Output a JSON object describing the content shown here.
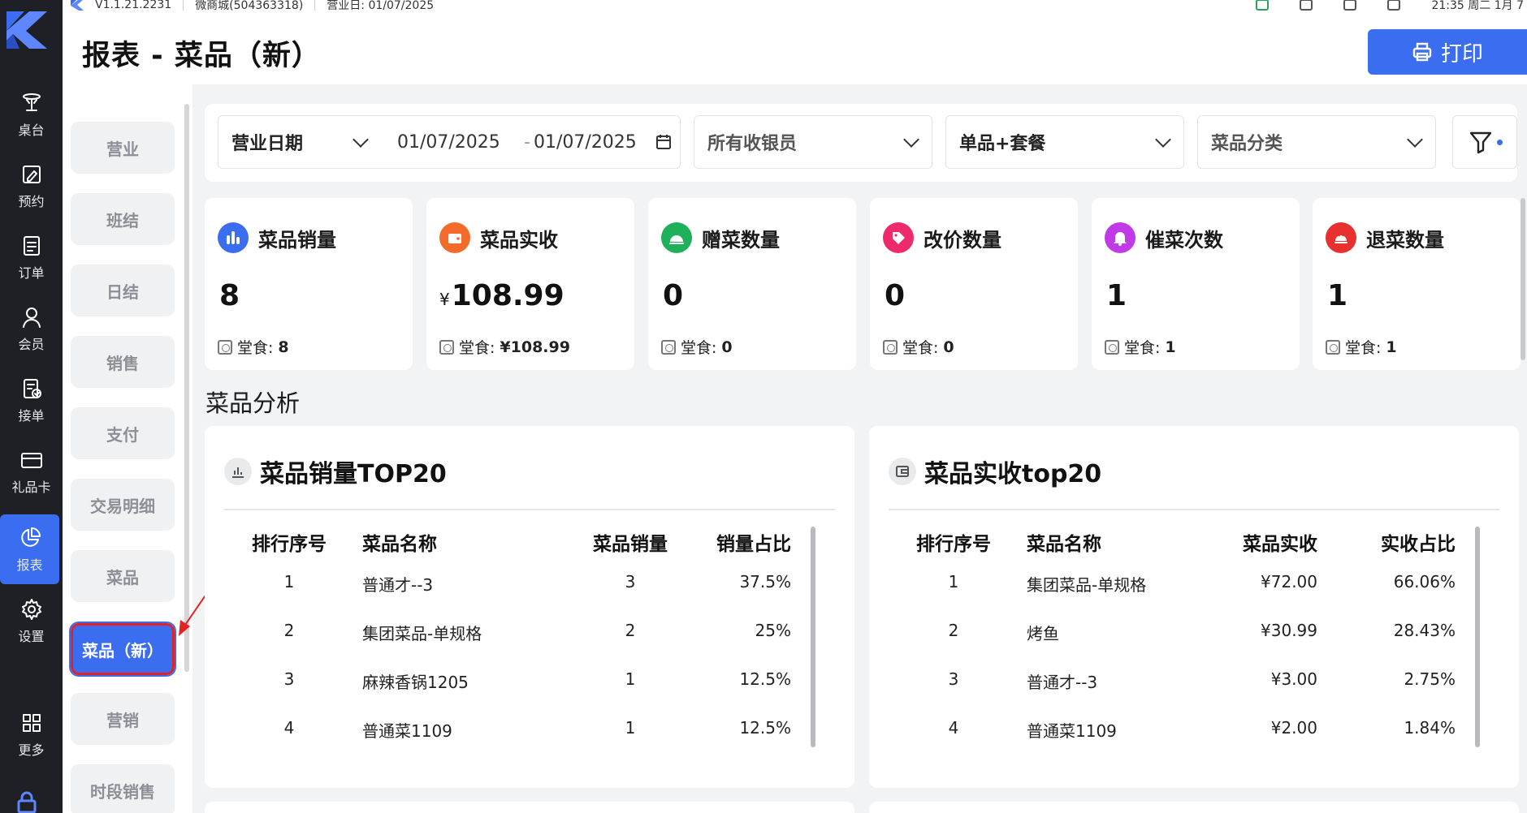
{
  "status": {
    "version": "V1.1.21.2231",
    "store": "微商城(504363318)",
    "business_day": "营业日: 01/07/2025",
    "clock": "21:35 周二 1月 7"
  },
  "header": {
    "title": "报表 - 菜品（新）",
    "print_label": "打印"
  },
  "rail": {
    "items": [
      {
        "label": "桌台",
        "icon": "table-lamp-icon"
      },
      {
        "label": "预约",
        "icon": "calendar-edit-icon"
      },
      {
        "label": "订单",
        "icon": "order-list-icon"
      },
      {
        "label": "会员",
        "icon": "user-icon"
      },
      {
        "label": "接单",
        "icon": "accept-order-icon"
      },
      {
        "label": "礼品卡",
        "icon": "gift-card-icon"
      },
      {
        "label": "报表",
        "icon": "pie-chart-icon",
        "active": true
      },
      {
        "label": "设置",
        "icon": "gear-icon"
      },
      {
        "label": "更多",
        "icon": "grid-icon"
      }
    ]
  },
  "categories": [
    {
      "label": "营业"
    },
    {
      "label": "班结"
    },
    {
      "label": "日结"
    },
    {
      "label": "销售"
    },
    {
      "label": "支付"
    },
    {
      "label": "交易明细"
    },
    {
      "label": "菜品"
    },
    {
      "label": "菜品（新）",
      "active": true
    },
    {
      "label": "营销"
    },
    {
      "label": "时段销售"
    }
  ],
  "filters": {
    "date_type": "营业日期",
    "date_from": "01/07/2025",
    "date_sep": "-",
    "date_to": "01/07/2025",
    "cashier": "所有收银员",
    "item_type": "单品+套餐",
    "dish_category": "菜品分类"
  },
  "cards": [
    {
      "title": "菜品销量",
      "value": "8",
      "currency": "",
      "sub_label": "堂食:",
      "sub_value": "8",
      "color": "#3b6df0",
      "icon": "bar-chart-icon"
    },
    {
      "title": "菜品实收",
      "value": "108.99",
      "currency": "¥",
      "sub_label": "堂食:",
      "sub_value": "¥108.99",
      "color": "#f26b2a",
      "icon": "wallet-icon"
    },
    {
      "title": "赠菜数量",
      "value": "0",
      "currency": "",
      "sub_label": "堂食:",
      "sub_value": "0",
      "color": "#1fb05a",
      "icon": "cloche-icon"
    },
    {
      "title": "改价数量",
      "value": "0",
      "currency": "",
      "sub_label": "堂食:",
      "sub_value": "0",
      "color": "#ee2a6b",
      "icon": "price-tag-icon"
    },
    {
      "title": "催菜次数",
      "value": "1",
      "currency": "",
      "sub_label": "堂食:",
      "sub_value": "1",
      "color": "#c03ae8",
      "icon": "bell-icon"
    },
    {
      "title": "退菜数量",
      "value": "1",
      "currency": "",
      "sub_label": "堂食:",
      "sub_value": "1",
      "color": "#e8312f",
      "icon": "return-dish-icon"
    }
  ],
  "analysis": {
    "section_title": "菜品分析",
    "sales_top": {
      "title": "菜品销量TOP20",
      "columns": [
        "排行序号",
        "菜品名称",
        "菜品销量",
        "销量占比"
      ],
      "rows": [
        [
          "1",
          "普通才--3",
          "3",
          "37.5%"
        ],
        [
          "2",
          "集团菜品-单规格",
          "2",
          "25%"
        ],
        [
          "3",
          "麻辣香锅1205",
          "1",
          "12.5%"
        ],
        [
          "4",
          "普通菜1109",
          "1",
          "12.5%"
        ]
      ]
    },
    "revenue_top": {
      "title": "菜品实收top20",
      "columns": [
        "排行序号",
        "菜品名称",
        "菜品实收",
        "实收占比"
      ],
      "rows": [
        [
          "1",
          "集团菜品-单规格",
          "¥72.00",
          "66.06%"
        ],
        [
          "2",
          "烤鱼",
          "¥30.99",
          "28.43%"
        ],
        [
          "3",
          "普通才--3",
          "¥3.00",
          "2.75%"
        ],
        [
          "4",
          "普通菜1109",
          "¥2.00",
          "1.84%"
        ]
      ]
    }
  },
  "colors": {
    "accent": "#3b6df0",
    "rail_bg": "#1f2026",
    "highlight": "#e02424"
  }
}
